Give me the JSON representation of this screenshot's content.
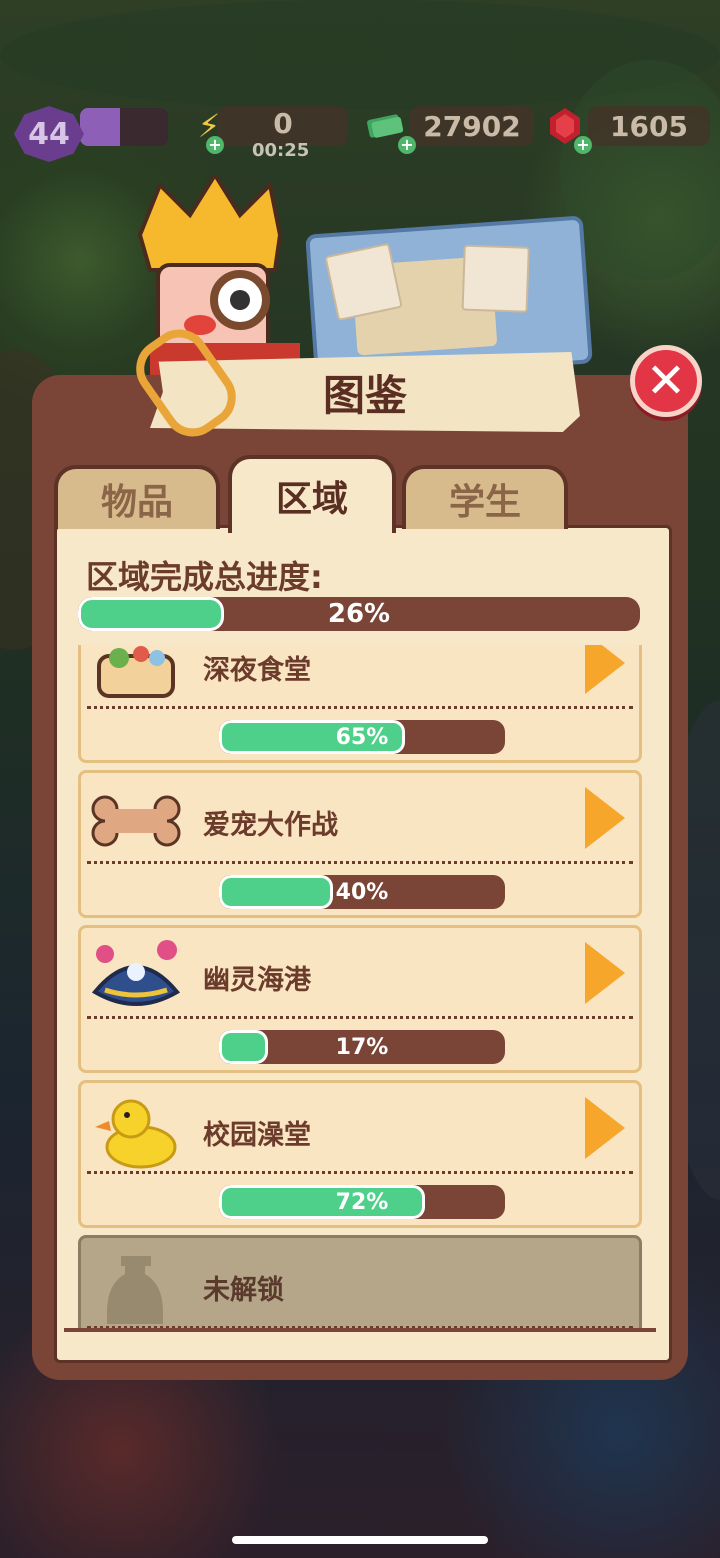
{
  "hud": {
    "level": "44",
    "level_progress": 0.45,
    "energy": "0",
    "energy_timer": "00:25",
    "cash": "27902",
    "gems": "1605"
  },
  "panel": {
    "title": "图鉴",
    "tabs": [
      {
        "label": "物品",
        "active": false
      },
      {
        "label": "区域",
        "active": true
      },
      {
        "label": "学生",
        "active": false
      }
    ],
    "progress_label": "区域完成总进度:",
    "total_progress": 26,
    "total_progress_text": "26%"
  },
  "areas": [
    {
      "name": "深夜食堂",
      "progress": 65,
      "progress_text": "65%",
      "icon": "bento-box-icon"
    },
    {
      "name": "爱宠大作战",
      "progress": 40,
      "progress_text": "40%",
      "icon": "dog-bone-icon"
    },
    {
      "name": "幽灵海港",
      "progress": 17,
      "progress_text": "17%",
      "icon": "pirate-hat-icon"
    },
    {
      "name": "校园澡堂",
      "progress": 72,
      "progress_text": "72%",
      "icon": "rubber-duck-icon"
    },
    {
      "name": "未解锁",
      "locked": true,
      "icon": "locked-silhouette-icon"
    }
  ],
  "colors": {
    "panel_border": "#7a4436",
    "panel_fill": "#f6e8c8",
    "progress_green": "#4fd08a",
    "close_red": "#e23545",
    "arrow_orange": "#f6a62b"
  }
}
